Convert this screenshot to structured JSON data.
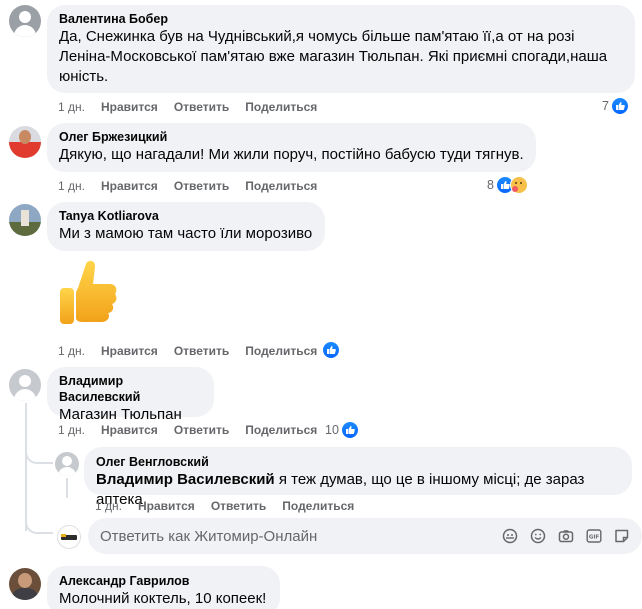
{
  "comments": [
    {
      "author": "Валентина Бобер",
      "text_lines": [
        "Да, Снежинка був на Чуднівський,я чомусь більше пам'ятаю її,а от на розі",
        "Леніна-Московської пам'ятаю вже магазин Тюльпан. Які приємні спогади,наша",
        "юність."
      ],
      "time": "1 дн.",
      "like": "Нравится",
      "reply": "Ответить",
      "share": "Поделиться",
      "reaction_count": "7",
      "reactions": [
        "like-icon"
      ]
    },
    {
      "author": "Олег Бржезицкий",
      "text": "Дякую, що нагадали! Ми жили поруч, постійно бабусю туди тягнув.",
      "time": "1 дн.",
      "like": "Нравится",
      "reply": "Ответить",
      "share": "Поделиться",
      "reaction_count": "8",
      "reactions": [
        "like-icon",
        "hug-icon"
      ]
    },
    {
      "author": "Tanya Kotliarova",
      "text": "Ми з мамою там часто їли морозиво",
      "sticker": "thumbs-up-emoji",
      "time": "1 дн.",
      "like": "Нравится",
      "reply": "Ответить",
      "share": "Поделиться",
      "reactions": [
        "like-icon"
      ]
    },
    {
      "author": "Владимир Василевский",
      "text": "Магазин Тюльпан",
      "time": "1 дн.",
      "like": "Нравится",
      "reply": "Ответить",
      "share": "Поделиться",
      "reaction_count": "10",
      "reactions": [
        "like-icon"
      ]
    },
    {
      "author": "Олег Венгловский",
      "mention": "Владимир Василевский",
      "text": " я теж думав, що це в іншому місці; де зараз аптека",
      "time": "1 дн.",
      "like": "Нравится",
      "reply": "Ответить",
      "share": "Поделиться"
    },
    {
      "author": "Александр Гаврилов",
      "text": "Молочний коктель, 10 копеек!"
    }
  ],
  "reply_box": {
    "placeholder": "Ответить как Житомир-Онлайн",
    "icons": [
      "avatar-sticker-icon",
      "emoji-icon",
      "camera-icon",
      "gif-icon",
      "sticker-icon"
    ]
  },
  "colors": {
    "bubble": "#f0f2f5",
    "meta_text": "#65676b",
    "like_blue": "#0866ff"
  }
}
